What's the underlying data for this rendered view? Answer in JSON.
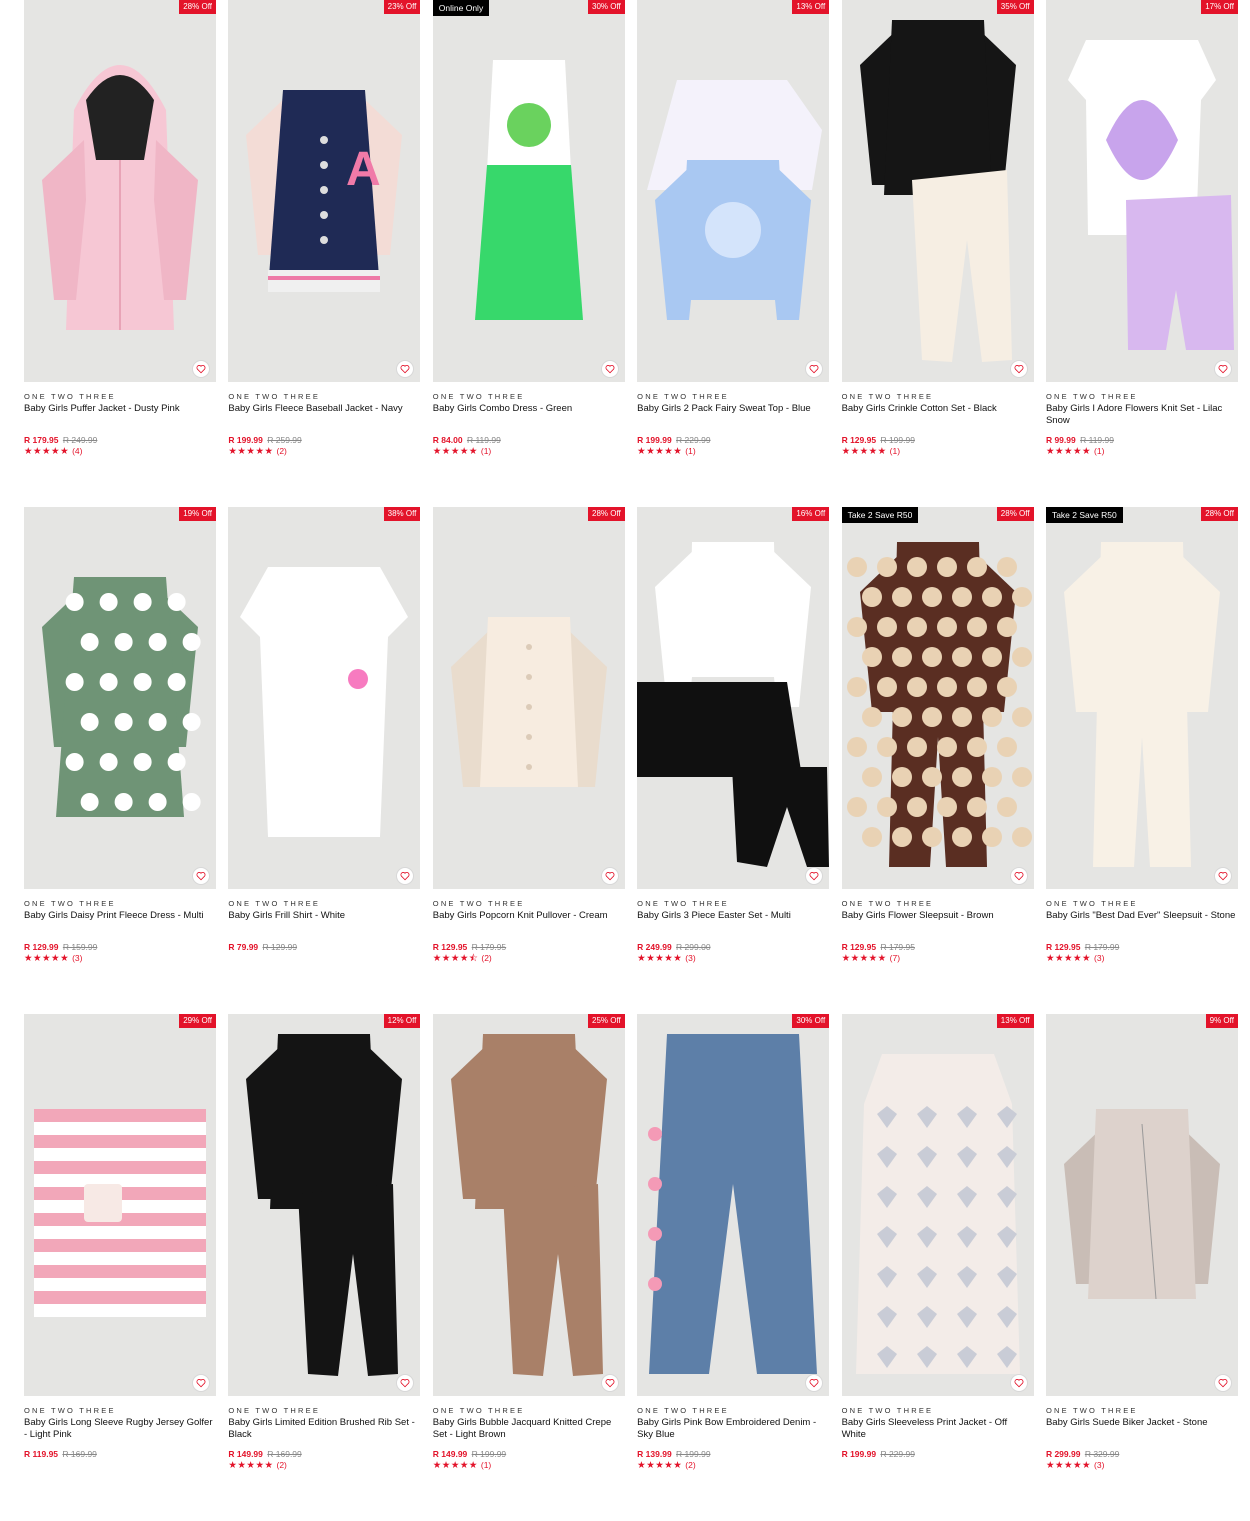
{
  "theme": {
    "sale_red": "#e3132a",
    "promo_black": "#000000",
    "image_bg": "#e5e5e3"
  },
  "products": [
    {
      "brand": "ONE TWO THREE",
      "name": "Baby Girls Puffer Jacket - Dusty Pink",
      "price": "R 179.95",
      "was": "R 249.99",
      "discount": "28% Off",
      "promo": "",
      "stars": "★★★★★",
      "reviews": "(4)",
      "art": "jacket-hood",
      "c1": "#f6c7d4",
      "c2": "#f0b6c6"
    },
    {
      "brand": "ONE TWO THREE",
      "name": "Baby Girls Fleece Baseball Jacket - Navy",
      "price": "R 199.99",
      "was": "R 259.99",
      "discount": "23% Off",
      "promo": "",
      "stars": "★★★★★",
      "reviews": "(2)",
      "art": "varsity",
      "c1": "#1f2a55",
      "c2": "#f3dcd6"
    },
    {
      "brand": "ONE TWO THREE",
      "name": "Baby Girls Combo Dress - Green",
      "price": "R 84.00",
      "was": "R 119.99",
      "discount": "30% Off",
      "promo": "Online Only",
      "stars": "★★★★★",
      "reviews": "(1)",
      "art": "dress",
      "c1": "#ffffff",
      "c2": "#37d86b"
    },
    {
      "brand": "ONE TWO THREE",
      "name": "Baby Girls 2 Pack Fairy Sweat Top - Blue",
      "price": "R 199.99",
      "was": "R 229.99",
      "discount": "13% Off",
      "promo": "",
      "stars": "★★★★★",
      "reviews": "(1)",
      "art": "twotops",
      "c1": "#f4f2fb",
      "c2": "#a9c8f2"
    },
    {
      "brand": "ONE TWO THREE",
      "name": "Baby Girls Crinkle Cotton Set - Black",
      "price": "R 129.95",
      "was": "R 199.99",
      "discount": "35% Off",
      "promo": "",
      "stars": "★★★★★",
      "reviews": "(1)",
      "art": "topleggings",
      "c1": "#151515",
      "c2": "#f6eee3"
    },
    {
      "brand": "ONE TWO THREE",
      "name": "Baby Girls I Adore Flowers Knit Set - Lilac Snow",
      "price": "R 99.99",
      "was": "R 119.99",
      "discount": "17% Off",
      "promo": "",
      "stars": "★★★★★",
      "reviews": "(1)",
      "art": "teeshorts",
      "c1": "#ffffff",
      "c2": "#d8b8ef"
    },
    {
      "brand": "ONE TWO THREE",
      "name": "Baby Girls Daisy Print Fleece Dress - Multi",
      "price": "R 129.99",
      "was": "R 159.99",
      "discount": "19% Off",
      "promo": "",
      "stars": "★★★★★",
      "reviews": "(3)",
      "art": "sweaterdress",
      "c1": "#6f9476",
      "c2": "#ffffff"
    },
    {
      "brand": "ONE TWO THREE",
      "name": "Baby Girls Frill Shirt - White",
      "price": "R 79.99",
      "was": "R 129.99",
      "discount": "38% Off",
      "promo": "",
      "stars": "",
      "reviews": "",
      "art": "tee",
      "c1": "#ffffff",
      "c2": "#f77bc0"
    },
    {
      "brand": "ONE TWO THREE",
      "name": "Baby Girls Popcorn Knit Pullover - Cream",
      "price": "R 129.95",
      "was": "R 179.95",
      "discount": "28% Off",
      "promo": "",
      "stars": "★★★★⯪",
      "reviews": "(2)",
      "art": "cardigan",
      "c1": "#f7ece0",
      "c2": "#e9dccd"
    },
    {
      "brand": "ONE TWO THREE",
      "name": "Baby Girls 3 Piece Easter Set - Multi",
      "price": "R 249.99",
      "was": "R 299.00",
      "discount": "16% Off",
      "promo": "",
      "stars": "★★★★★",
      "reviews": "(3)",
      "art": "topskirt",
      "c1": "#ffffff",
      "c2": "#101010"
    },
    {
      "brand": "ONE TWO THREE",
      "name": "Baby Girls Flower Sleepsuit - Brown",
      "price": "R 129.95",
      "was": "R 179.95",
      "discount": "28% Off",
      "promo": "Take 2 Save R50",
      "stars": "★★★★★",
      "reviews": "(7)",
      "art": "sleepsuit",
      "c1": "#5a2e22",
      "c2": "#f5a9c4"
    },
    {
      "brand": "ONE TWO THREE",
      "name": "Baby Girls \"Best Dad Ever\" Sleepsuit - Stone",
      "price": "R 129.95",
      "was": "R 179.99",
      "discount": "28% Off",
      "promo": "Take 2 Save R50",
      "stars": "★★★★★",
      "reviews": "(3)",
      "art": "sleepsuit",
      "c1": "#f8f1e6",
      "c2": "#f8f1e6"
    },
    {
      "brand": "ONE TWO THREE",
      "name": "Baby Girls Long Sleeve Rugby Jersey Golfer - Light Pink",
      "price": "R 119.95",
      "was": "R 169.99",
      "discount": "29% Off",
      "promo": "",
      "stars": "",
      "reviews": "",
      "art": "rugby",
      "c1": "#f2a7b9",
      "c2": "#ffffff"
    },
    {
      "brand": "ONE TWO THREE",
      "name": "Baby Girls Limited Edition Brushed Rib Set - Black",
      "price": "R 149.99",
      "was": "R 169.99",
      "discount": "12% Off",
      "promo": "",
      "stars": "★★★★★",
      "reviews": "(2)",
      "art": "topleggings",
      "c1": "#141414",
      "c2": "#141414"
    },
    {
      "brand": "ONE TWO THREE",
      "name": "Baby Girls Bubble Jacquard Knitted Crepe Set - Light Brown",
      "price": "R 149.99",
      "was": "R 199.99",
      "discount": "25% Off",
      "promo": "",
      "stars": "★★★★★",
      "reviews": "(1)",
      "art": "topleggings",
      "c1": "#a98068",
      "c2": "#a98068"
    },
    {
      "brand": "ONE TWO THREE",
      "name": "Baby Girls Pink Bow Embroidered Denim - Sky Blue",
      "price": "R 139.99",
      "was": "R 199.99",
      "discount": "30% Off",
      "promo": "",
      "stars": "★★★★★",
      "reviews": "(2)",
      "art": "jeans",
      "c1": "#5d7fa8",
      "c2": "#f49ab6"
    },
    {
      "brand": "ONE TWO THREE",
      "name": "Baby Girls Sleeveless Print Jacket - Off White",
      "price": "R 199.99",
      "was": "R 229.99",
      "discount": "13% Off",
      "promo": "",
      "stars": "",
      "reviews": "",
      "art": "vest",
      "c1": "#f3ece8",
      "c2": "#c9ccd6"
    },
    {
      "brand": "ONE TWO THREE",
      "name": "Baby Girls Suede Biker Jacket - Stone",
      "price": "R 299.99",
      "was": "R 329.99",
      "discount": "9% Off",
      "promo": "",
      "stars": "★★★★★",
      "reviews": "(3)",
      "art": "jacket",
      "c1": "#ddd2cc",
      "c2": "#c9bdb6"
    }
  ]
}
